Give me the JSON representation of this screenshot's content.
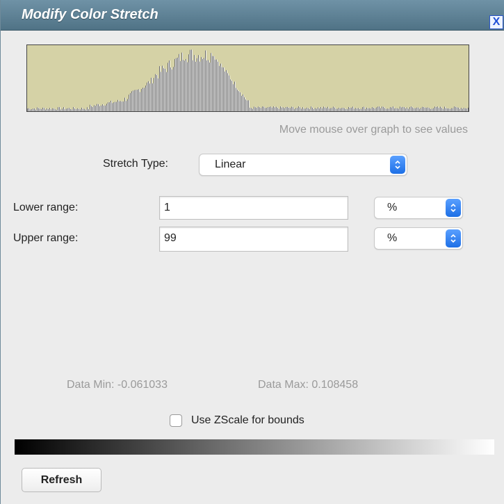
{
  "dialog": {
    "title": "Modify Color Stretch",
    "close_label": "X"
  },
  "histogram": {
    "hint": "Move mouse over graph to see values",
    "colors": {
      "background": "#d5d2a6",
      "low": "#000000",
      "high": "#ffffff"
    }
  },
  "stretch": {
    "label": "Stretch Type:",
    "value": "Linear"
  },
  "ranges": {
    "lower_label": "Lower range:",
    "lower_value": "1",
    "lower_unit": "%",
    "upper_label": "Upper range:",
    "upper_value": "99",
    "upper_unit": "%"
  },
  "data": {
    "min_text": "Data Min: -0.061033",
    "max_text": "Data Max: 0.108458"
  },
  "zscale": {
    "label": "Use ZScale for bounds",
    "checked": false
  },
  "actions": {
    "refresh_label": "Refresh"
  },
  "colors": {
    "titlebar": "#5b7f93",
    "select_accent": "#1d6fe6"
  },
  "icons": {
    "close": "close-icon",
    "select_arrow": "up-down-chevron-icon"
  }
}
